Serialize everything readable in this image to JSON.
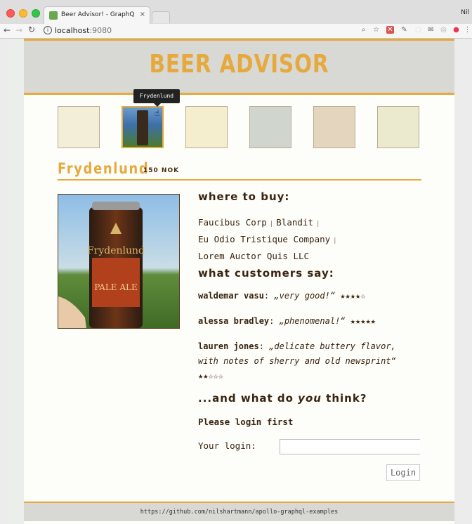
{
  "browser": {
    "tab_title": "Beer Advisor! - GraphQL Java",
    "tab_close": "×",
    "profile_name": "Nil",
    "url_host": "localhost",
    "url_port": ":9080",
    "icons": [
      "back-arrow-icon",
      "forward-arrow-icon",
      "reload-icon",
      "info-icon",
      "zoom-icon",
      "star-icon"
    ]
  },
  "header": {
    "title": "BEER ADVISOR"
  },
  "thumbnails": {
    "tooltip": "Frydenlund",
    "colors": [
      "#e9dcb1",
      "#3d6fa8",
      "#eadc9c",
      "#9aa69c",
      "#c8a678",
      "#d7d19c"
    ]
  },
  "beer": {
    "name": "Frydenlund",
    "price": "150 NOK",
    "can_text": "Frydenlund",
    "can_label": "PALE ALE"
  },
  "where_to_buy": {
    "heading": "where to buy:",
    "shops": [
      "Faucibus Corp",
      "Blandit",
      "Eu Odio Tristique Company",
      "Lorem Auctor Quis LLC"
    ],
    "separator": "|"
  },
  "ratings": {
    "heading": "what customers say:",
    "items": [
      {
        "author": "waldemar vasu",
        "quote": "„very good!“",
        "stars": "★★★★☆"
      },
      {
        "author": "alessa bradley",
        "quote": "„phenomenal!“",
        "stars": "★★★★★"
      },
      {
        "author": "lauren jones",
        "quote": "„delicate buttery flavor,",
        "quote2": "with notes of sherry and old newsprint“",
        "stars": "★★☆☆☆"
      }
    ]
  },
  "feedback": {
    "heading_prefix": "...and what do ",
    "heading_emph": "you",
    "heading_suffix": " think?",
    "login_first": "Please login first",
    "login_label": "Your login:",
    "login_value": "",
    "login_button": "Login"
  },
  "footer": {
    "link": "https://github.com/nilshartmann/apollo-graphql-examples"
  },
  "colors": {
    "accent": "#e6a93d",
    "dark": "#3a2410"
  }
}
